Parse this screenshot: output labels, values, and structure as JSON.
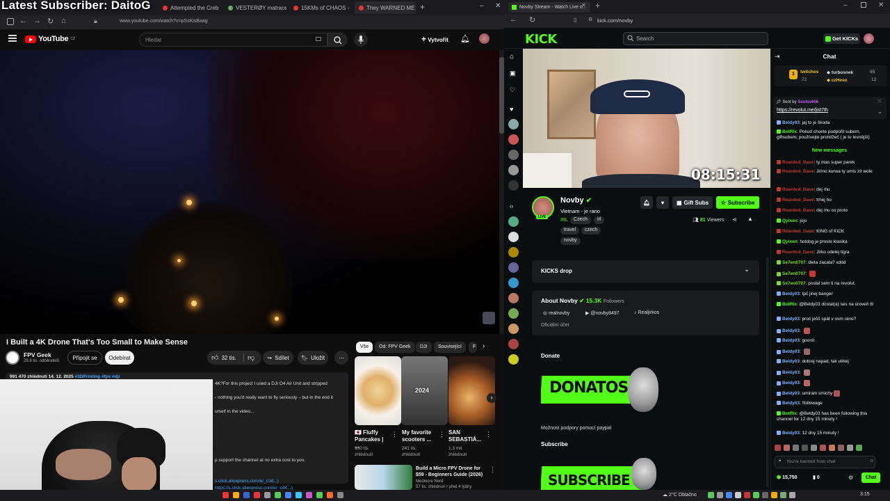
{
  "overlay": {
    "latest_subscriber": "Latest Subscriber: DaitoG"
  },
  "left_browser": {
    "tabs": [
      "Attempted the Creb Tr...",
      "VESTERØY matrace s tai...",
      "15KMs of CHAOS - Abu...",
      "They WARNED ME Not..."
    ],
    "url": "www.youtube.com/watch?v=pSsKisBaag"
  },
  "youtube": {
    "logo": "YouTube",
    "logo_region": "CZ",
    "search_placeholder": "Hledat",
    "create_label": "Vytvořit",
    "video": {
      "title": "I Built a 4K Drone That's Too Small to Make Sense",
      "channel": "FPV Geek",
      "subscribers": "29.8 tis. odběratelů",
      "join_label": "Připojit se",
      "subscribe_label": "Odebírat",
      "likes": "32 tis.",
      "share_label": "Sdílet",
      "save_label": "Uložit",
      "views_date": "991 470 zhlédnutí  14. 12. 2025",
      "hashtags": "#3DPrinting #fpv #dji",
      "desc_lines": [
        "4K?For this project I used a DJI O4 Air Unit and stripped",
        "- nothing you'd really want to fly seriously – but in the end it",
        "urself in the video...",
        "p support the channel at no extra cost to you.",
        "s.click.aliexpress.com/e/_c3d...)",
        "https://s.click.aliexpress.com/e/_c4K...)"
      ]
    },
    "chips": [
      "Vše",
      "Od: FPV Geek",
      "DJI",
      "Související",
      "F"
    ],
    "recommended": [
      {
        "title": "🇯🇵 Fluffy Pancakes | ...",
        "meta1": "930 tis.",
        "meta2": "zhlédnutí"
      },
      {
        "title": "My favorite scooters ...",
        "meta1": "241 tis.",
        "meta2": "zhlédnutí",
        "badge": "2024"
      },
      {
        "title": "SAN SEBASTIÁ...",
        "meta1": "1,3 mil.",
        "meta2": "zhlédnutí"
      }
    ],
    "rec_row": {
      "title": "Build a Micro FPV Drone for $59 - Beginners Guide (2026)",
      "channel": "Mediocre Nerd",
      "meta": "57 tis. zhlédnutí • před 4 týdny"
    }
  },
  "right_browser": {
    "tab_title": "Novby Stream - Watch Live o...",
    "url": "kick.com/novby"
  },
  "kick": {
    "logo": "KICK",
    "search_placeholder": "Search",
    "get_kicks": "Get KICKs",
    "stream_timer": "08:15:31",
    "streamer": {
      "name": "Novby",
      "live_badge": "LIVE",
      "title": "Vietnam - je rano",
      "category": "IRL",
      "tags": [
        "Czech",
        "irl",
        "travel",
        "czech",
        "novby"
      ],
      "viewers": "81",
      "viewers_label": "Viewers",
      "gift_subs": "Gift Subs",
      "subscribe": "Subscribe"
    },
    "kicks_drop": "KICKS drop",
    "about": {
      "heading": "About Novby",
      "followers": "15.3K",
      "followers_label": "Followers",
      "socials": [
        "realnovby",
        "@novby8497",
        "Realjirkos"
      ],
      "official": "Oficiální účet"
    },
    "donate": {
      "heading": "Donate",
      "banner": "DONATOSS",
      "caption": "Možnost podpory pomocí paypal"
    },
    "subscribe_section": {
      "heading": "Subscribe",
      "banner": "SUBSCRIBE"
    }
  },
  "chat": {
    "header": "Chat",
    "leaderboard": [
      {
        "name": "twitchos",
        "value": "72",
        "rank": "1"
      },
      {
        "name": "turbosnek",
        "value": "65"
      },
      {
        "name": "czHeso",
        "value": "12"
      }
    ],
    "pinned": {
      "sent_by_label": "Sent by",
      "sender": "Saulos666",
      "link": "https://revolut.me/jist7th"
    },
    "new_messages_label": "New messages",
    "messages": [
      {
        "user": "Beldy03",
        "color": "#7fb2ff",
        "text": "jaj to je škoda"
      },
      {
        "user": "BotRix",
        "color": "#53fc18",
        "text": "Pokud chcete podpořit subem, giftsubem, používejte prohlížeč ( je to levnější)"
      },
      {
        "user": "Roarded_Dave",
        "color": "#c0392b",
        "text": "ty mas super parek"
      },
      {
        "user": "Roarded_Dave",
        "color": "#c0392b",
        "text": "Jirino kurwa ty umis zit wole"
      },
      {
        "user": "Roarded_Dave",
        "color": "#c0392b",
        "text": "dej mu"
      },
      {
        "user": "Roarded_Dave",
        "color": "#c0392b",
        "text": "trhej ho"
      },
      {
        "user": "Roarded_Dave",
        "color": "#c0392b",
        "text": "dej mu co proto"
      },
      {
        "user": "Qyixen",
        "color": "#53fc18",
        "text": "jojo"
      },
      {
        "user": "Roarded_Dave",
        "color": "#c0392b",
        "text": "KING of KICK"
      },
      {
        "user": "Qyixen",
        "color": "#53fc18",
        "text": "hotdog je proste klasika"
      },
      {
        "user": "Roarded_Dave",
        "color": "#c0392b",
        "text": "Jirko udelej tigra"
      },
      {
        "user": "Se7en0707",
        "color": "#7fdd2a",
        "text": "dieta zacala? xddd"
      },
      {
        "user": "Se7en0707",
        "color": "#7fdd2a",
        "text": ""
      },
      {
        "user": "Se7en0707",
        "color": "#7fdd2a",
        "text": "poslal sem ti na revolut."
      },
      {
        "user": "Beldy03",
        "color": "#7fb2ff",
        "text": "tpč jinej banger"
      },
      {
        "user": "BotRix",
        "color": "#53fc18",
        "text": "@Beldy03 dostal(a) ses na úroveň 6!"
      },
      {
        "user": "Beldy03",
        "color": "#7fb2ff",
        "text": "proč ješš spát v osm ráno?"
      },
      {
        "user": "Beldy03",
        "color": "#7fb2ff",
        "text": ""
      },
      {
        "user": "Beldy03",
        "color": "#7fb2ff",
        "text": "goonit"
      },
      {
        "user": "Beldy03",
        "color": "#7fb2ff",
        "text": ""
      },
      {
        "user": "Beldy03",
        "color": "#7fb2ff",
        "text": "dobrej napad, tak utikej"
      },
      {
        "user": "Beldy03",
        "color": "#7fb2ff",
        "text": ""
      },
      {
        "user": "Beldy03",
        "color": "#7fb2ff",
        "text": ""
      },
      {
        "user": "Beldy03",
        "color": "#7fb2ff",
        "text": "umiram smichy"
      },
      {
        "user": "Beldy03",
        "color": "#7fb2ff",
        "text": "!followage"
      },
      {
        "user": "BotRix",
        "color": "#53fc18",
        "text": "@Beldy03 has been following this channel for 12 dny 15 minuty !"
      },
      {
        "user": "Beldy03",
        "color": "#7fb2ff",
        "text": "12 dny 15 minuty !"
      }
    ],
    "banned_placeholder": "You're banned from chat",
    "kicks_balance": "15,750",
    "points": "0",
    "chat_button": "Chat"
  },
  "taskbar": {
    "weather": "2°C  Oblačno",
    "time": "3:15"
  }
}
